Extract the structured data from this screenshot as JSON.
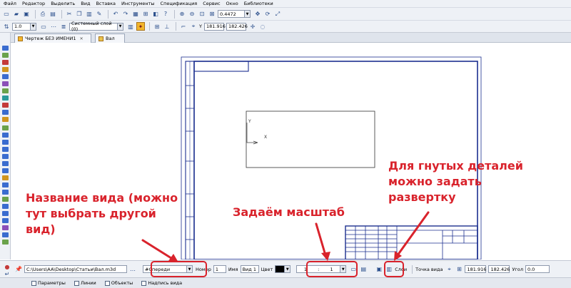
{
  "menu": [
    "Файл",
    "Редактор",
    "Выделить",
    "Вид",
    "Вставка",
    "Инструменты",
    "Спецификация",
    "Сервис",
    "Окно",
    "Библиотеки"
  ],
  "toolbar1": {
    "zoom_value": "0.4472"
  },
  "toolbar2": {
    "step_value": "1.0",
    "layer_value": "Системный слой (0)",
    "coord_label": "Y",
    "coord_x": "181.916",
    "coord_y": "182.426"
  },
  "tabs": [
    {
      "label": "Чертеж БЕЗ ИМЕНИ1"
    },
    {
      "label": "Вал"
    }
  ],
  "drawing": {
    "axis_y": "Y",
    "axis_x": "X"
  },
  "properties": {
    "model_path": "C:\\Users\\AA\\Desktop\\Статьи\\Вал.m3d",
    "view_name": "#Спереди",
    "number_label": "Номер",
    "number_value": "1",
    "name_label": "Имя",
    "name_value": "Вид 1",
    "color_label": "Цвет",
    "scale_left": "1",
    "scale_sep": ":",
    "scale_right": "1",
    "layers_label": "Слои",
    "view_point_label": "Точка вида",
    "view_x": "181.916",
    "view_y": "182.426",
    "angle_label": "Угол",
    "angle_value": "0.0"
  },
  "bottom_tabs": [
    "Параметры",
    "Линии",
    "Объекты",
    "Надпись вида"
  ],
  "annotations": {
    "view_name": [
      "Название вида (можно",
      "тут выбрать другой",
      "вид)"
    ],
    "scale": [
      "Задаём масштаб"
    ],
    "unfold": [
      "Для гнутых деталей",
      "можно задать",
      "развертку"
    ]
  },
  "colors": {
    "annotation": "#d9232c",
    "frame": "#1c2f8f",
    "toolbar_bg": "#eef1f6"
  }
}
